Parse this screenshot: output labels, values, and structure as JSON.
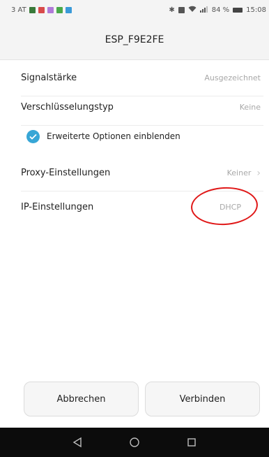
{
  "status_bar": {
    "carrier": "3 AT",
    "battery_percent": "84 %",
    "time": "15:08",
    "left_icons": [
      "notification-icon",
      "gallery-icon",
      "app-icon",
      "app-icon",
      "sim-icon"
    ],
    "right_icons": [
      "bluetooth-icon",
      "vibrate-icon",
      "wifi-icon",
      "signal-icon",
      "battery-icon"
    ]
  },
  "dialog": {
    "title": "ESP_F9E2FE"
  },
  "rows": {
    "signal": {
      "label": "Signalstärke",
      "value": "Ausgezeichnet"
    },
    "encryption": {
      "label": "Verschlüsselungstyp",
      "value": "Keine"
    },
    "proxy": {
      "label": "Proxy-Einstellungen",
      "value": "Keiner"
    },
    "ip": {
      "label": "IP-Einstellungen",
      "value": "DHCP"
    }
  },
  "advanced_options": {
    "label": "Erweiterte Optionen einblenden",
    "checked": true
  },
  "buttons": {
    "cancel": "Abbrechen",
    "connect": "Verbinden"
  },
  "colors": {
    "accent": "#37a6d6",
    "annotation": "#e01818",
    "navbar": "#0c0c0c"
  },
  "nav_icons": [
    "back-icon",
    "home-icon",
    "recents-icon"
  ]
}
